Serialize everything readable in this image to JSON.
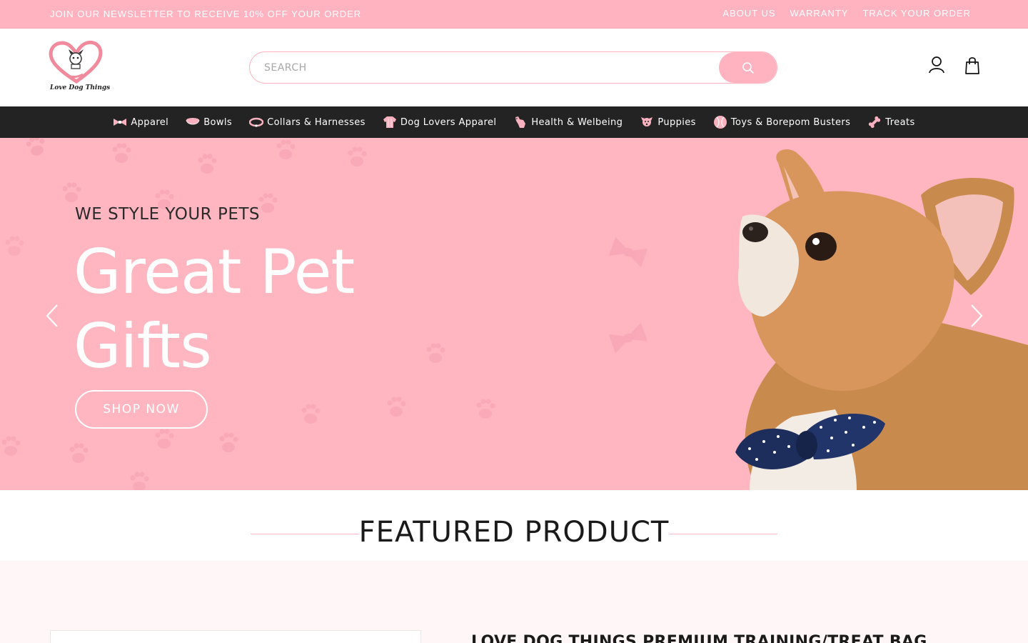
{
  "announcement": {
    "promo": "JOIN OUR NEWSLETTER TO RECEIVE 10% OFF YOUR ORDER",
    "links": [
      "ABOUT US",
      "WARRANTY",
      "TRACK YOUR ORDER"
    ]
  },
  "header": {
    "logo_text": "Love Dog Things",
    "search_placeholder": "SEARCH",
    "icons": [
      "account-icon",
      "cart-icon"
    ]
  },
  "nav": {
    "items": [
      {
        "label": "Apparel",
        "icon": "bow-icon"
      },
      {
        "label": "Bowls",
        "icon": "bowl-icon"
      },
      {
        "label": "Collars & Harnesses",
        "icon": "collar-icon"
      },
      {
        "label": "Dog Lovers Apparel",
        "icon": "sweater-icon"
      },
      {
        "label": "Health & Welbeing",
        "icon": "dog-care-icon"
      },
      {
        "label": "Puppies",
        "icon": "puppy-icon"
      },
      {
        "label": "Toys & Borepom Busters",
        "icon": "ball-icon"
      },
      {
        "label": "Treats",
        "icon": "bone-icon"
      }
    ]
  },
  "hero": {
    "kicker": "WE STYLE YOUR PETS",
    "headline": "Great Pet Gifts",
    "cta": "SHOP NOW"
  },
  "featured": {
    "heading": "FEATURED PRODUCT",
    "product_title": "LOVE DOG THINGS PREMIUM TRAINING/TREAT BAG"
  },
  "colors": {
    "accent_pink": "#ffb3c0",
    "hero_bg": "#ffb6c1",
    "nav_bg": "#232323"
  }
}
